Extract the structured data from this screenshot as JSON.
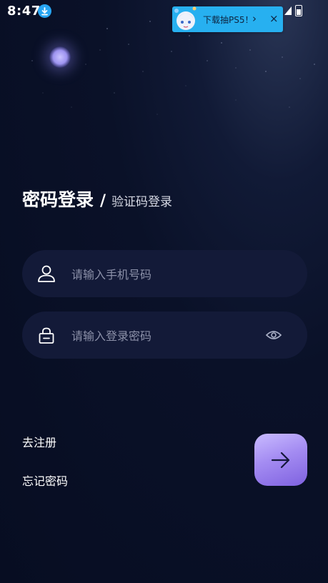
{
  "status_bar": {
    "time": "8:47"
  },
  "ad_banner": {
    "text": "下载抽PS5！",
    "arrow": "›",
    "close": "×"
  },
  "login": {
    "tab_password": "密码登录",
    "separator": "/",
    "tab_code": "验证码登录",
    "phone_placeholder": "请输入手机号码",
    "password_placeholder": "请输入登录密码"
  },
  "links": {
    "register": "去注册",
    "forgot": "忘记密码"
  },
  "icons": {
    "download": "download-icon",
    "user": "user-icon",
    "lock": "lock-icon",
    "eye": "eye-icon",
    "submit": "arrow-right-icon"
  },
  "colors": {
    "background": "#070d22",
    "field": "#131a38",
    "accent": "#a48cf2",
    "ad": "#27b0f0"
  }
}
